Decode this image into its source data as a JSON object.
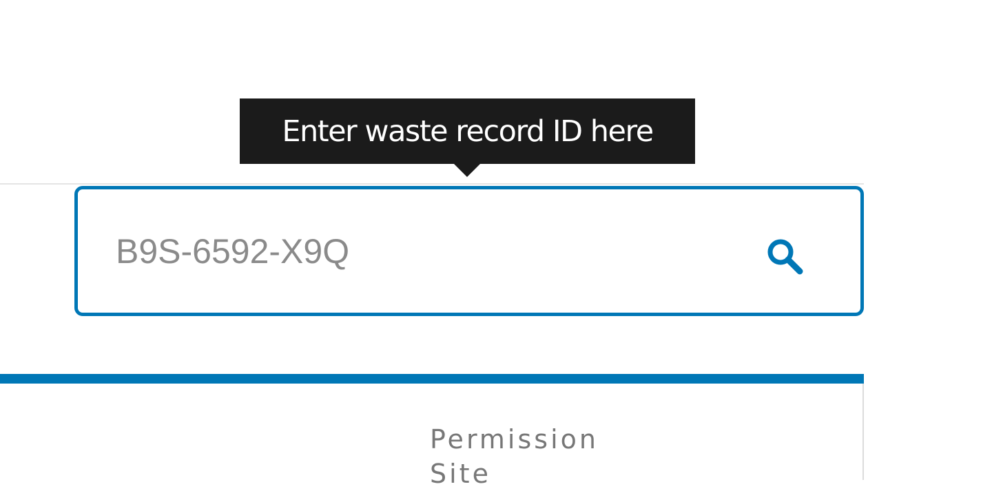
{
  "tooltip": {
    "text": "Enter waste record ID here"
  },
  "search": {
    "value": "B9S-6592-X9Q",
    "icon": "search-icon"
  },
  "table": {
    "columns": [
      {
        "label": "Permission Site"
      }
    ]
  },
  "colors": {
    "accent": "#0077b6",
    "tooltip_bg": "#1b1b1b",
    "input_text": "#8a8a8a",
    "header_text": "#777777"
  }
}
